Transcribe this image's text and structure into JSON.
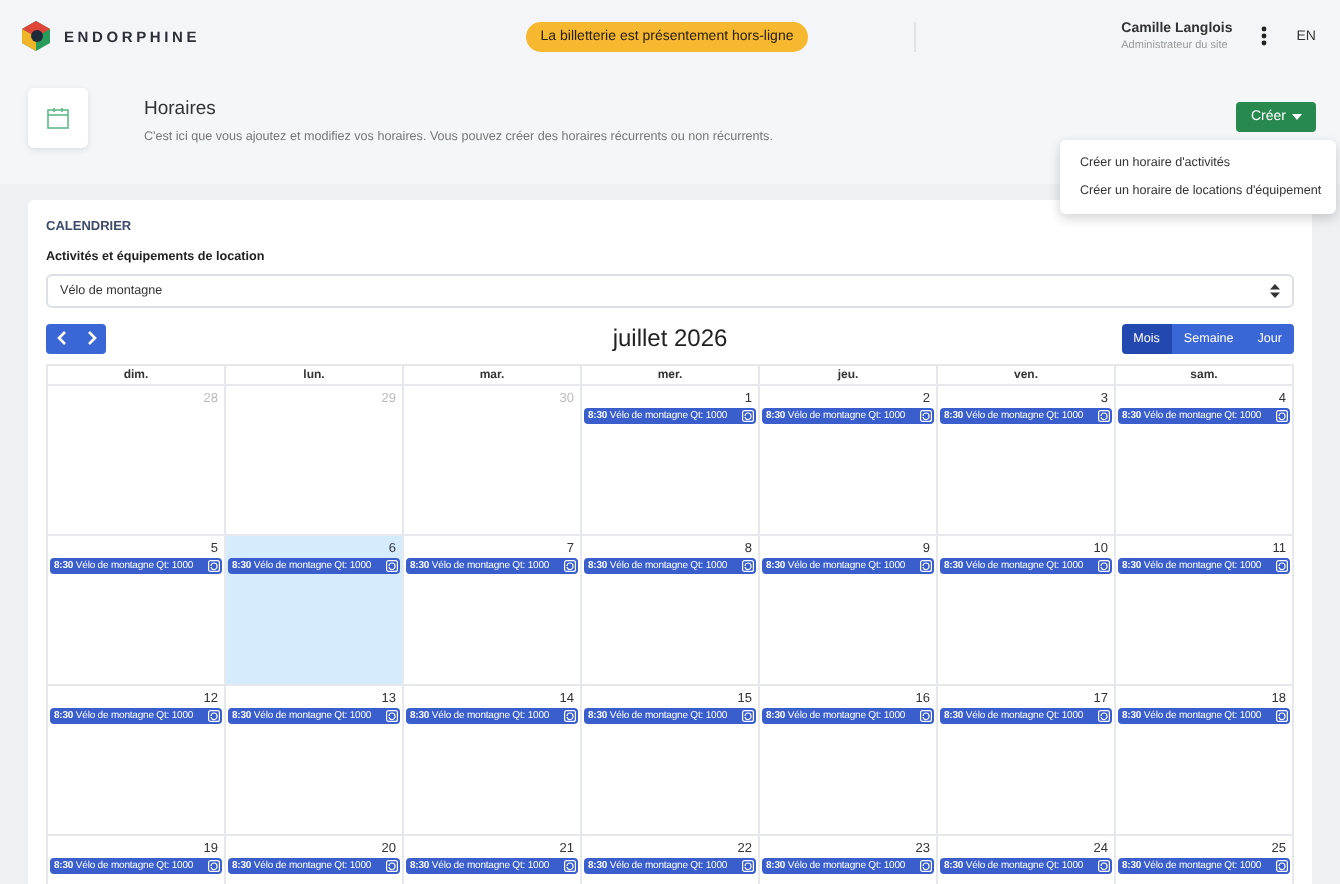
{
  "header": {
    "brand": "ENDORPHINE",
    "notice": "La billetterie est présentement hors-ligne",
    "user_name": "Camille Langlois",
    "user_role": "Administrateur du site",
    "language": "EN"
  },
  "page": {
    "title": "Horaires",
    "description": "C'est ici que vous ajoutez et modifiez vos horaires. Vous pouvez créer des horaires récurrents ou non récurrents.",
    "create_button": "Créer",
    "create_menu": {
      "expanded": true,
      "items": [
        "Créer un horaire d'activités",
        "Créer un horaire de locations d'équipement"
      ]
    }
  },
  "calendar": {
    "heading": "CALENDRIER",
    "filter_label": "Activités et équipements de location",
    "filter_value": "Vélo de montagne",
    "month_title": "juillet 2026",
    "views": [
      {
        "label": "Mois",
        "selected": true
      },
      {
        "label": "Semaine",
        "selected": false
      },
      {
        "label": "Jour",
        "selected": false
      }
    ],
    "weekdays": [
      "dim.",
      "lun.",
      "mar.",
      "mer.",
      "jeu.",
      "ven.",
      "sam."
    ],
    "weeks": [
      {
        "days": [
          {
            "date": "28",
            "other_month": true,
            "today": false
          },
          {
            "date": "29",
            "other_month": true,
            "today": false
          },
          {
            "date": "30",
            "other_month": true,
            "today": false
          },
          {
            "date": "1",
            "other_month": false,
            "today": false,
            "events": [
              {
                "time": "8:30",
                "title": "Vélo de montagne Qt: 1000"
              }
            ]
          },
          {
            "date": "2",
            "other_month": false,
            "today": false,
            "events": [
              {
                "time": "8:30",
                "title": "Vélo de montagne Qt: 1000"
              }
            ]
          },
          {
            "date": "3",
            "other_month": false,
            "today": false,
            "events": [
              {
                "time": "8:30",
                "title": "Vélo de montagne Qt: 1000"
              }
            ]
          },
          {
            "date": "4",
            "other_month": false,
            "today": false,
            "events": [
              {
                "time": "8:30",
                "title": "Vélo de montagne Qt: 1000"
              }
            ]
          }
        ]
      },
      {
        "days": [
          {
            "date": "5",
            "other_month": false,
            "today": false,
            "events": [
              {
                "time": "8:30",
                "title": "Vélo de montagne Qt: 1000"
              }
            ]
          },
          {
            "date": "6",
            "other_month": false,
            "today": true,
            "events": [
              {
                "time": "8:30",
                "title": "Vélo de montagne Qt: 1000"
              }
            ]
          },
          {
            "date": "7",
            "other_month": false,
            "today": false,
            "events": [
              {
                "time": "8:30",
                "title": "Vélo de montagne Qt: 1000"
              }
            ]
          },
          {
            "date": "8",
            "other_month": false,
            "today": false,
            "events": [
              {
                "time": "8:30",
                "title": "Vélo de montagne Qt: 1000"
              }
            ]
          },
          {
            "date": "9",
            "other_month": false,
            "today": false,
            "events": [
              {
                "time": "8:30",
                "title": "Vélo de montagne Qt: 1000"
              }
            ]
          },
          {
            "date": "10",
            "other_month": false,
            "today": false,
            "events": [
              {
                "time": "8:30",
                "title": "Vélo de montagne Qt: 1000"
              }
            ]
          },
          {
            "date": "11",
            "other_month": false,
            "today": false,
            "events": [
              {
                "time": "8:30",
                "title": "Vélo de montagne Qt: 1000"
              }
            ]
          }
        ]
      },
      {
        "days": [
          {
            "date": "12",
            "other_month": false,
            "today": false,
            "events": [
              {
                "time": "8:30",
                "title": "Vélo de montagne Qt: 1000"
              }
            ]
          },
          {
            "date": "13",
            "other_month": false,
            "today": false,
            "events": [
              {
                "time": "8:30",
                "title": "Vélo de montagne Qt: 1000"
              }
            ]
          },
          {
            "date": "14",
            "other_month": false,
            "today": false,
            "events": [
              {
                "time": "8:30",
                "title": "Vélo de montagne Qt: 1000"
              }
            ]
          },
          {
            "date": "15",
            "other_month": false,
            "today": false,
            "events": [
              {
                "time": "8:30",
                "title": "Vélo de montagne Qt: 1000"
              }
            ]
          },
          {
            "date": "16",
            "other_month": false,
            "today": false,
            "events": [
              {
                "time": "8:30",
                "title": "Vélo de montagne Qt: 1000"
              }
            ]
          },
          {
            "date": "17",
            "other_month": false,
            "today": false,
            "events": [
              {
                "time": "8:30",
                "title": "Vélo de montagne Qt: 1000"
              }
            ]
          },
          {
            "date": "18",
            "other_month": false,
            "today": false,
            "events": [
              {
                "time": "8:30",
                "title": "Vélo de montagne Qt: 1000"
              }
            ]
          }
        ]
      },
      {
        "days": [
          {
            "date": "19",
            "other_month": false,
            "today": false,
            "events": [
              {
                "time": "8:30",
                "title": "Vélo de montagne Qt: 1000"
              }
            ]
          },
          {
            "date": "20",
            "other_month": false,
            "today": false,
            "events": [
              {
                "time": "8:30",
                "title": "Vélo de montagne Qt: 1000"
              }
            ]
          },
          {
            "date": "21",
            "other_month": false,
            "today": false,
            "events": [
              {
                "time": "8:30",
                "title": "Vélo de montagne Qt: 1000"
              }
            ]
          },
          {
            "date": "22",
            "other_month": false,
            "today": false,
            "events": [
              {
                "time": "8:30",
                "title": "Vélo de montagne Qt: 1000"
              }
            ]
          },
          {
            "date": "23",
            "other_month": false,
            "today": false,
            "events": [
              {
                "time": "8:30",
                "title": "Vélo de montagne Qt: 1000"
              }
            ]
          },
          {
            "date": "24",
            "other_month": false,
            "today": false,
            "events": [
              {
                "time": "8:30",
                "title": "Vélo de montagne Qt: 1000"
              }
            ]
          },
          {
            "date": "25",
            "other_month": false,
            "today": false,
            "events": [
              {
                "time": "8:30",
                "title": "Vélo de montagne Qt: 1000"
              }
            ]
          }
        ]
      }
    ]
  }
}
